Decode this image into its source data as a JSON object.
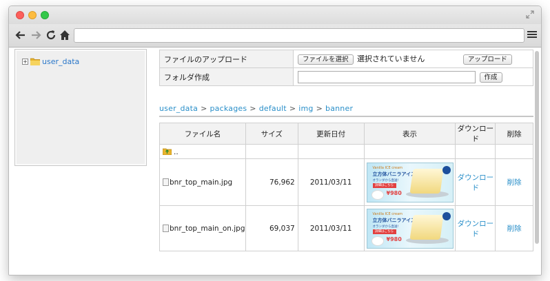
{
  "upload": {
    "label": "ファイルのアップロード",
    "choose_button": "ファイルを選択",
    "no_file_text": "選択されていません",
    "upload_button": "アップロード"
  },
  "folder": {
    "label": "フォルダ作成",
    "input_value": "",
    "create_button": "作成"
  },
  "tree": {
    "expand": "+",
    "root_label": "user_data"
  },
  "breadcrumb": [
    "user_data",
    "packages",
    "default",
    "img",
    "banner"
  ],
  "breadcrumb_sep": ">",
  "table": {
    "headers": [
      "ファイル名",
      "サイズ",
      "更新日付",
      "表示",
      "ダウンロード",
      "削除"
    ],
    "parent_label": "..",
    "rows": [
      {
        "name": "bnr_top_main.jpg",
        "size": "76,962",
        "date": "2011/03/11",
        "download": "ダウンロード",
        "delete": "削除"
      },
      {
        "name": "bnr_top_main_on.jpg",
        "size": "69,037",
        "date": "2011/03/11",
        "download": "ダウンロード",
        "delete": "削除"
      }
    ]
  },
  "banner": {
    "line1": "Vanilla ICE cream",
    "line2": "立方体バニラアイス",
    "line3": "オランダから直送!",
    "button": "詳細はこちら",
    "price": "¥980"
  }
}
